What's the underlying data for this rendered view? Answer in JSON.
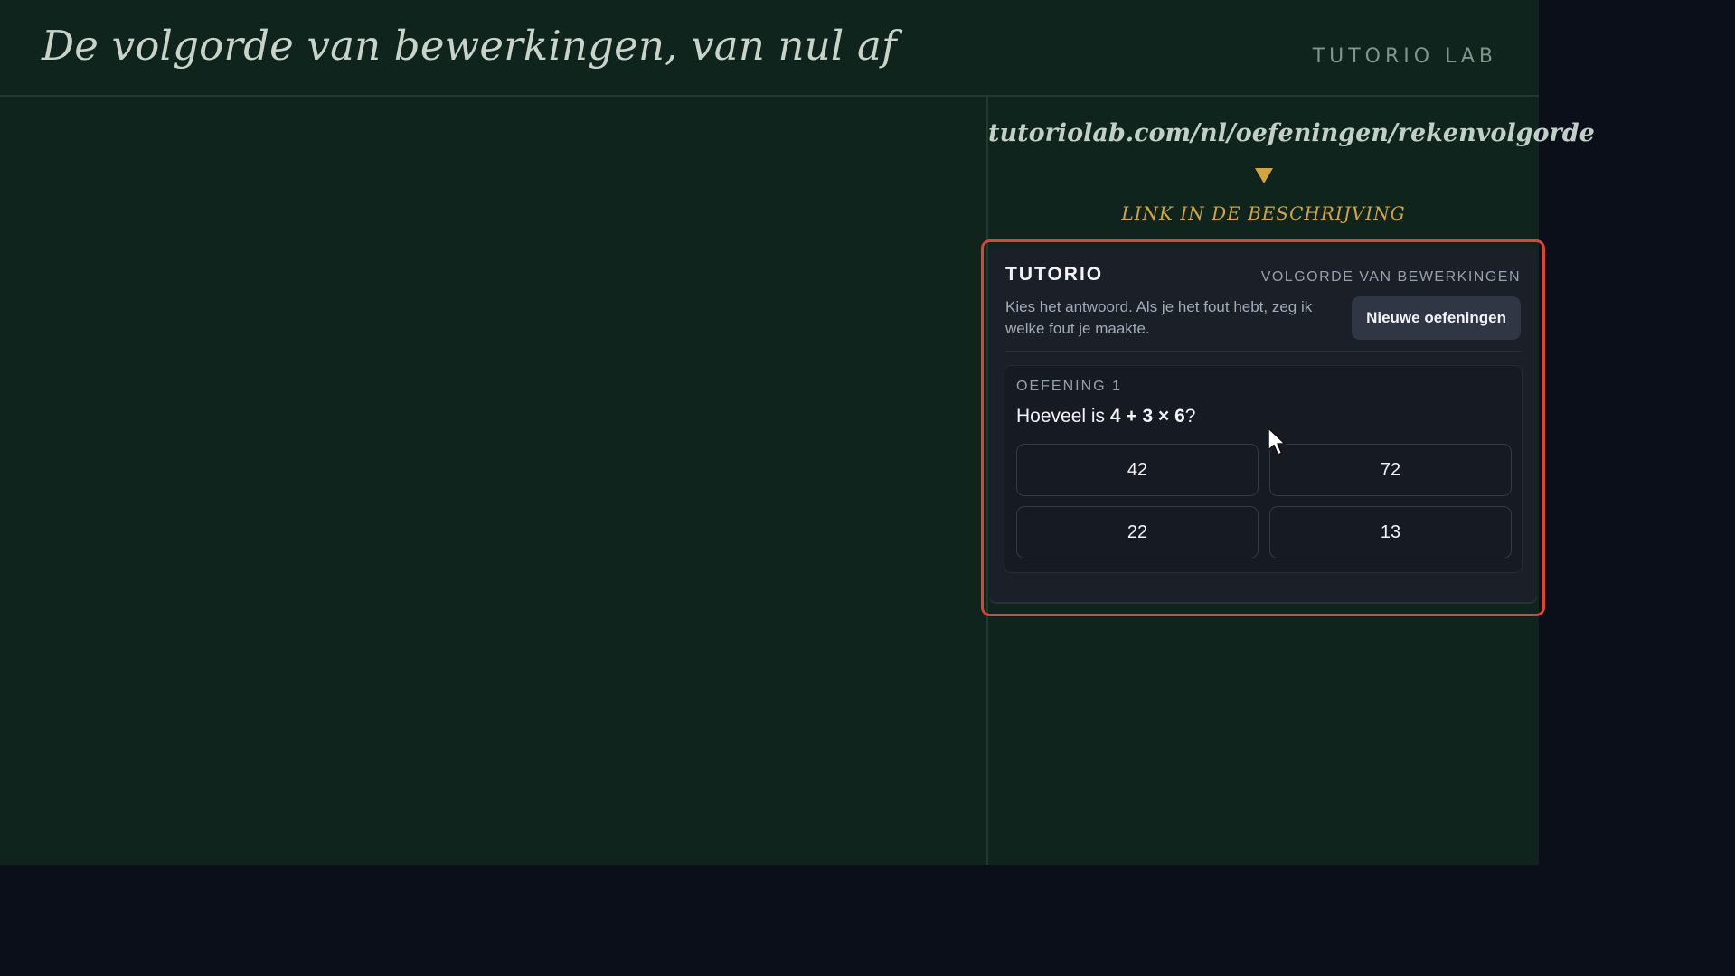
{
  "header": {
    "title": "De volgorde van bewerkingen, van nul af",
    "brand": "TUTORIO LAB"
  },
  "promo": {
    "url": "tutoriolab.com/nl/oefeningen/rekenvolgorde",
    "note": "LINK IN DE BESCHRIJVING"
  },
  "widget": {
    "brand": "TUTORIO",
    "topic": "VOLGORDE VAN BEWERKINGEN",
    "instructions": "Kies het antwoord. Als je het fout hebt, zeg ik welke fout je maakte.",
    "new_exercises_label": "Nieuwe oefeningen",
    "exercise": {
      "label": "OEFENING 1",
      "question_prefix": "Hoeveel is ",
      "question_expression": "4 + 3 × 6",
      "question_suffix": "?",
      "answers": [
        "42",
        "72",
        "22",
        "13"
      ]
    }
  },
  "colors": {
    "board": "#0e241d",
    "accent": "#d4a43f",
    "highlight": "#e0432f",
    "widget_bg": "#1a1f28"
  }
}
